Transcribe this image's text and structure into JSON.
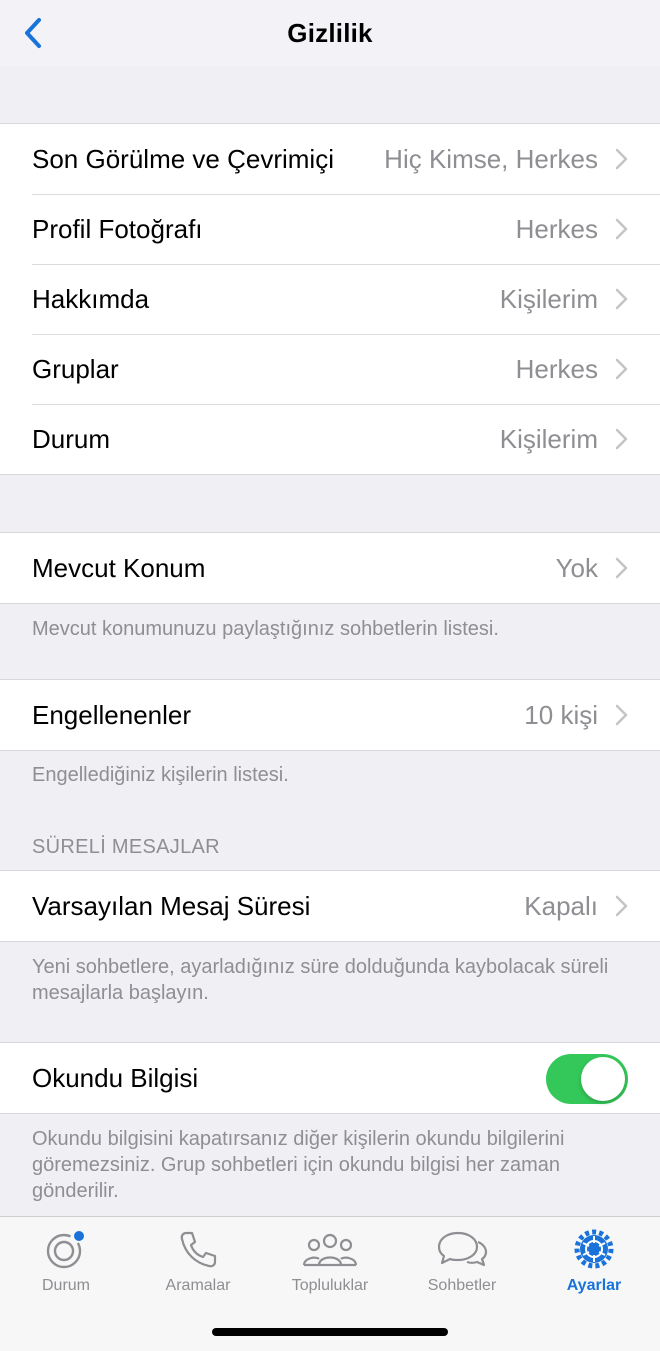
{
  "nav": {
    "title": "Gizlilik"
  },
  "group1": [
    {
      "label": "Son Görülme ve Çevrimiçi",
      "value": "Hiç Kimse, Herkes"
    },
    {
      "label": "Profil Fotoğrafı",
      "value": "Herkes"
    },
    {
      "label": "Hakkımda",
      "value": "Kişilerim"
    },
    {
      "label": "Gruplar",
      "value": "Herkes"
    },
    {
      "label": "Durum",
      "value": "Kişilerim"
    }
  ],
  "live_location": {
    "label": "Mevcut Konum",
    "value": "Yok",
    "note": "Mevcut konumunuzu paylaştığınız sohbetlerin listesi."
  },
  "blocked": {
    "label": "Engellenenler",
    "value": "10 kişi",
    "note": "Engellediğiniz kişilerin listesi."
  },
  "disappearing": {
    "header": "SÜRELİ MESAJLAR",
    "label": "Varsayılan Mesaj Süresi",
    "value": "Kapalı",
    "note": "Yeni sohbetlere, ayarladığınız süre dolduğunda kaybolacak süreli mesajlarla başlayın."
  },
  "read_receipts": {
    "label": "Okundu Bilgisi",
    "enabled": true,
    "note": "Okundu bilgisini kapatırsanız diğer kişilerin okundu bilgilerini göremezsiniz. Grup sohbetleri için okundu bilgisi her zaman gönderilir."
  },
  "tabs": [
    {
      "label": "Durum",
      "icon": "status-icon"
    },
    {
      "label": "Aramalar",
      "icon": "phone-icon"
    },
    {
      "label": "Topluluklar",
      "icon": "communities-icon"
    },
    {
      "label": "Sohbetler",
      "icon": "chats-icon"
    },
    {
      "label": "Ayarlar",
      "icon": "settings-icon",
      "active": true
    }
  ],
  "colors": {
    "accent": "#1a73d9",
    "toggle_on": "#34c759",
    "secondary_text": "#8e8e93",
    "background": "#efeff4"
  }
}
